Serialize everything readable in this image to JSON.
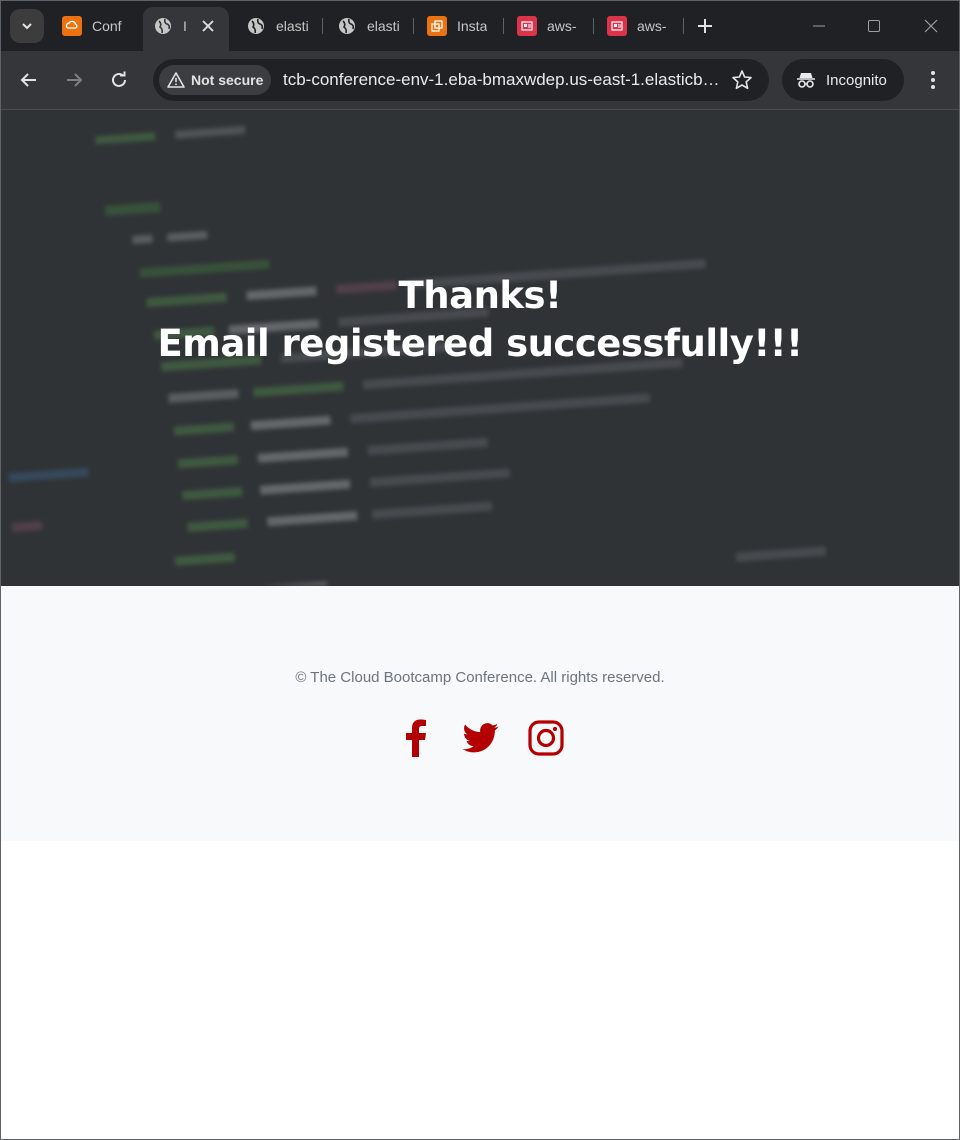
{
  "browser": {
    "tabs": [
      {
        "label": "Conf",
        "favicon": "orange-cloud-icon",
        "color": "#ec7211"
      },
      {
        "label": "I",
        "favicon": "globe-icon",
        "active": true
      },
      {
        "label": "elasti",
        "favicon": "globe-icon"
      },
      {
        "label": "elasti",
        "favicon": "globe-icon"
      },
      {
        "label": "Insta",
        "favicon": "orange-instances-icon",
        "color": "#ec7211"
      },
      {
        "label": "aws-",
        "favicon": "red-aws-icon",
        "color": "#dd344c"
      },
      {
        "label": "aws-",
        "favicon": "red-aws-icon",
        "color": "#dd344c"
      }
    ],
    "security_label": "Not secure",
    "url": "tcb-conference-env-1.eba-bmaxwdep.us-east-1.elasticbeanstalk.com",
    "incognito_label": "Incognito"
  },
  "hero": {
    "line1": "Thanks!",
    "line2": "Email registered successfully!!!"
  },
  "footer": {
    "copyright": "© The Cloud Bootcamp Conference. All rights reserved.",
    "social_color": "#b30000",
    "social": [
      "facebook-icon",
      "twitter-icon",
      "instagram-icon"
    ]
  }
}
